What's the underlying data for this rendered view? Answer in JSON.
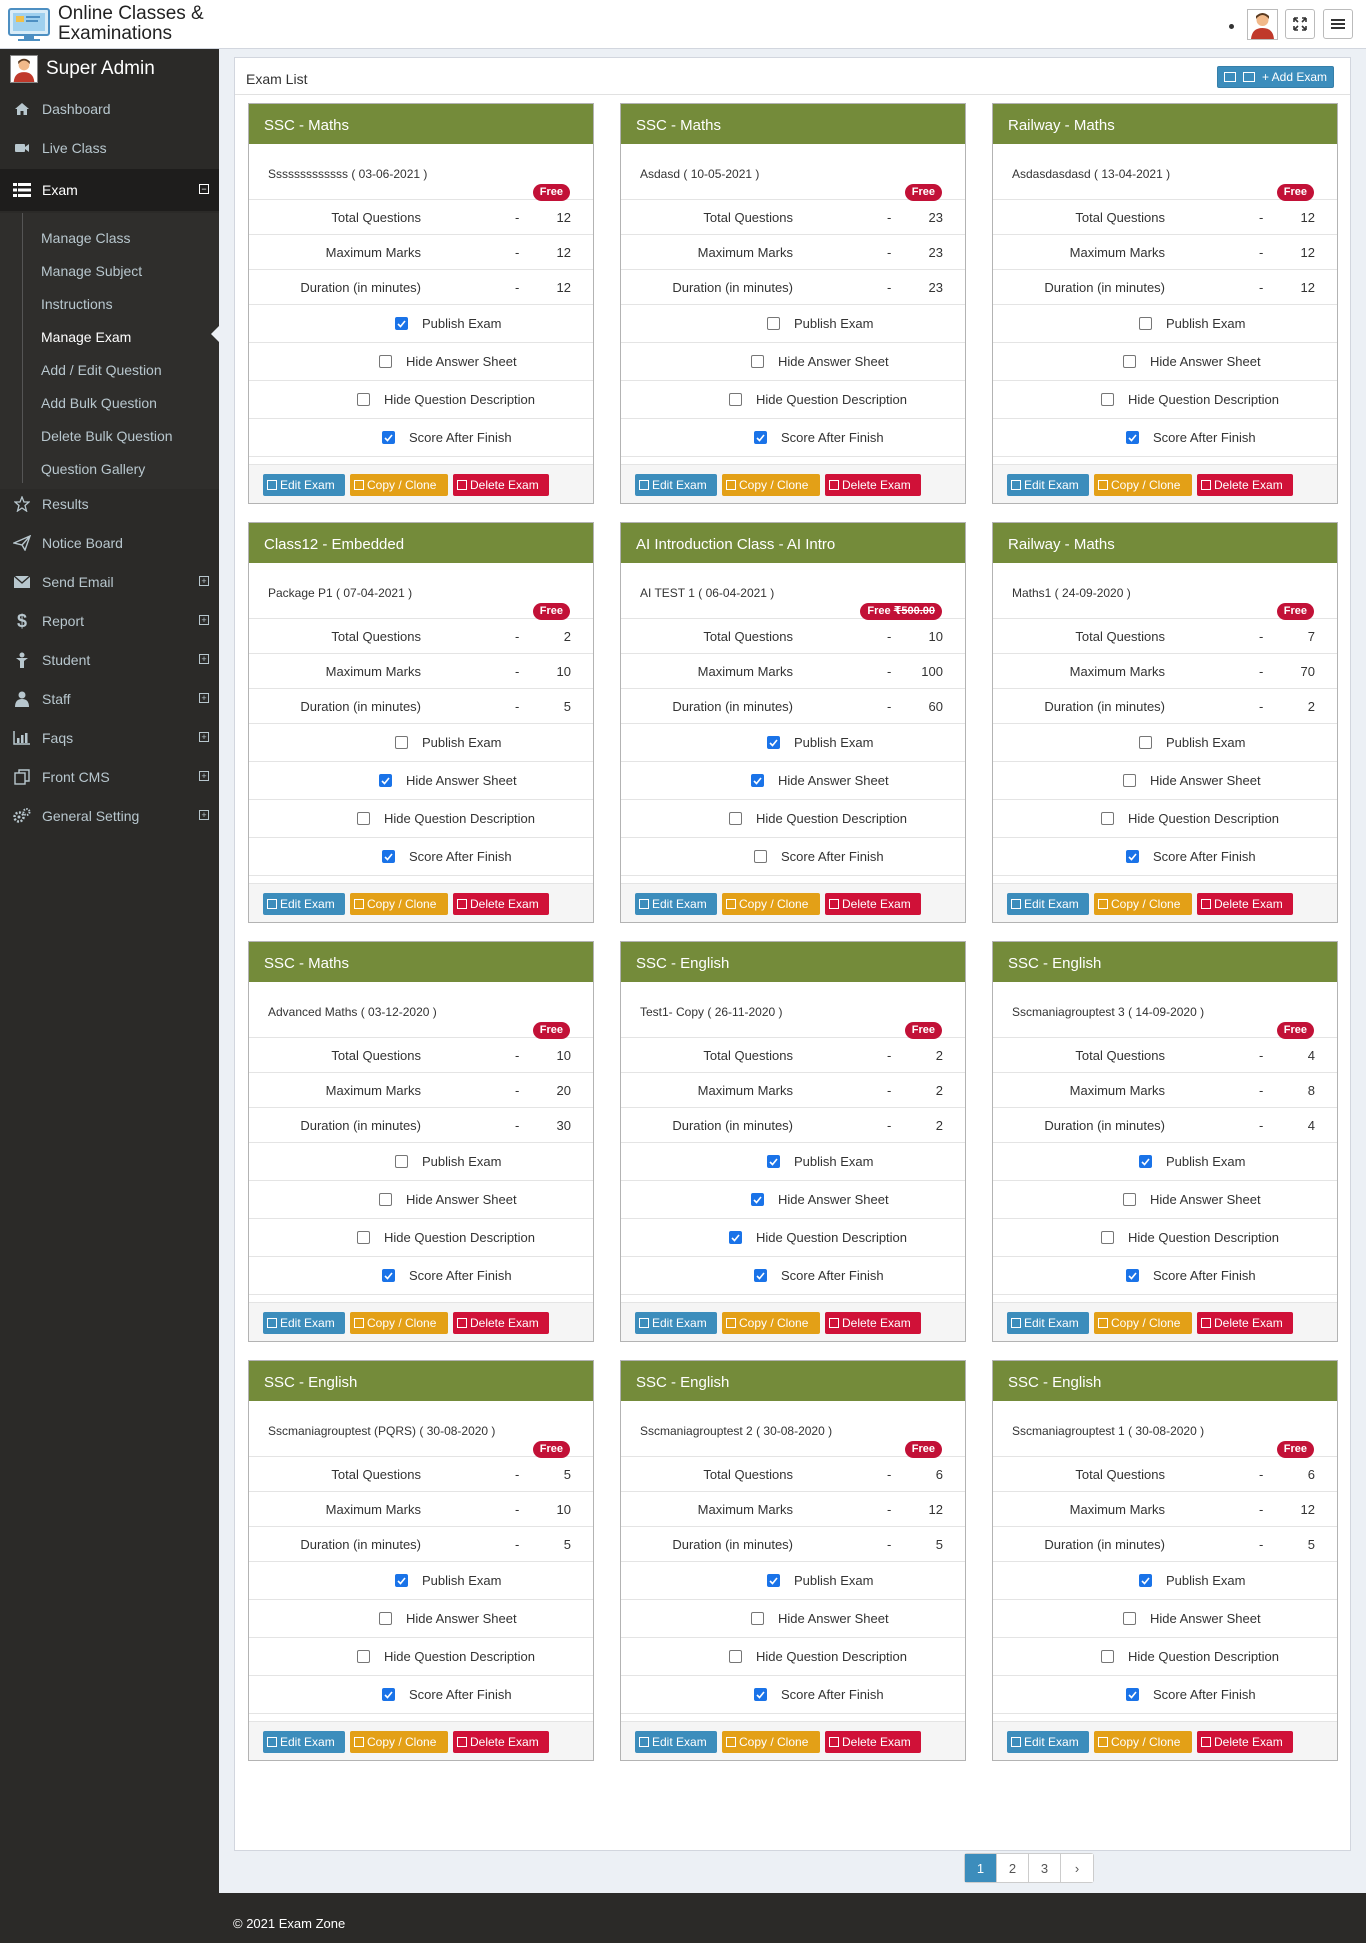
{
  "app": {
    "logo_line1": "Online Classes &",
    "logo_line2": "Examinations"
  },
  "sidebar": {
    "user": "Super Admin",
    "items": [
      {
        "label": "Dashboard"
      },
      {
        "label": "Live Class"
      },
      {
        "label": "Exam"
      },
      {
        "label": "Results"
      },
      {
        "label": "Notice Board"
      },
      {
        "label": "Send Email"
      },
      {
        "label": "Report"
      },
      {
        "label": "Student"
      },
      {
        "label": "Staff"
      },
      {
        "label": "Faqs"
      },
      {
        "label": "Front CMS"
      },
      {
        "label": "General Setting"
      }
    ],
    "exam_sub": [
      {
        "label": "Manage Class"
      },
      {
        "label": "Manage Subject"
      },
      {
        "label": "Instructions"
      },
      {
        "label": "Manage Exam"
      },
      {
        "label": "Add / Edit Question"
      },
      {
        "label": "Add Bulk Question"
      },
      {
        "label": "Delete Bulk Question"
      },
      {
        "label": "Question Gallery"
      }
    ]
  },
  "content": {
    "title": "Exam List",
    "add_label": "+ Add Exam"
  },
  "labels": {
    "total": "Total Questions",
    "max": "Maximum Marks",
    "duration": "Duration (in minutes)",
    "dash": "-",
    "publish": "Publish Exam",
    "hide_answer": "Hide Answer Sheet",
    "hide_desc": "Hide Question Description",
    "score": "Score After Finish",
    "edit": "Edit Exam",
    "clone": "Copy / Clone",
    "delete": "Delete Exam"
  },
  "cards": [
    {
      "title": "SSC - Maths",
      "name": "Sssssssssssss ( 03-06-2021 )",
      "badge": "Free",
      "badge_old": "",
      "total": "12",
      "max": "12",
      "duration": "12",
      "publish": true,
      "hide_answer": false,
      "hide_desc": false,
      "score": true
    },
    {
      "title": "SSC - Maths",
      "name": "Asdasd ( 10-05-2021 )",
      "badge": "Free",
      "badge_old": "",
      "total": "23",
      "max": "23",
      "duration": "23",
      "publish": false,
      "hide_answer": false,
      "hide_desc": false,
      "score": true
    },
    {
      "title": "Railway - Maths",
      "name": "Asdasdasdasd ( 13-04-2021 )",
      "badge": "Free",
      "badge_old": "",
      "total": "12",
      "max": "12",
      "duration": "12",
      "publish": false,
      "hide_answer": false,
      "hide_desc": false,
      "score": true
    },
    {
      "title": "Class12 - Embedded",
      "name": "Package P1 ( 07-04-2021 )",
      "badge": "Free",
      "badge_old": "",
      "total": "2",
      "max": "10",
      "duration": "5",
      "publish": false,
      "hide_answer": true,
      "hide_desc": false,
      "score": true
    },
    {
      "title": "AI Introduction Class - AI Intro",
      "name": "AI TEST 1 ( 06-04-2021 )",
      "badge": "Free",
      "badge_old": "₹500.00",
      "total": "10",
      "max": "100",
      "duration": "60",
      "publish": true,
      "hide_answer": true,
      "hide_desc": false,
      "score": false
    },
    {
      "title": "Railway - Maths",
      "name": "Maths1 ( 24-09-2020 )",
      "badge": "Free",
      "badge_old": "",
      "total": "7",
      "max": "70",
      "duration": "2",
      "publish": false,
      "hide_answer": false,
      "hide_desc": false,
      "score": true
    },
    {
      "title": "SSC - Maths",
      "name": "Advanced Maths ( 03-12-2020 )",
      "badge": "Free",
      "badge_old": "",
      "total": "10",
      "max": "20",
      "duration": "30",
      "publish": false,
      "hide_answer": false,
      "hide_desc": false,
      "score": true
    },
    {
      "title": "SSC - English",
      "name": "Test1- Copy ( 26-11-2020 )",
      "badge": "Free",
      "badge_old": "",
      "total": "2",
      "max": "2",
      "duration": "2",
      "publish": true,
      "hide_answer": true,
      "hide_desc": true,
      "score": true
    },
    {
      "title": "SSC - English",
      "name": "Sscmaniagrouptest 3 ( 14-09-2020 )",
      "badge": "Free",
      "badge_old": "",
      "total": "4",
      "max": "8",
      "duration": "4",
      "publish": true,
      "hide_answer": false,
      "hide_desc": false,
      "score": true
    },
    {
      "title": "SSC - English",
      "name": "Sscmaniagrouptest (PQRS) ( 30-08-2020 )",
      "badge": "Free",
      "badge_old": "",
      "total": "5",
      "max": "10",
      "duration": "5",
      "publish": true,
      "hide_answer": false,
      "hide_desc": false,
      "score": true
    },
    {
      "title": "SSC - English",
      "name": "Sscmaniagrouptest 2 ( 30-08-2020 )",
      "badge": "Free",
      "badge_old": "",
      "total": "6",
      "max": "12",
      "duration": "5",
      "publish": true,
      "hide_answer": false,
      "hide_desc": false,
      "score": true
    },
    {
      "title": "SSC - English",
      "name": "Sscmaniagrouptest 1 ( 30-08-2020 )",
      "badge": "Free",
      "badge_old": "",
      "total": "6",
      "max": "12",
      "duration": "5",
      "publish": true,
      "hide_answer": false,
      "hide_desc": false,
      "score": true
    }
  ],
  "pagination": [
    "1",
    "2",
    "3",
    "›"
  ],
  "footer": "© 2021 Exam Zone",
  "colors": {
    "card_header": "#748b3a",
    "badge": "#c21137",
    "edit": "#3c8dbc",
    "clone": "#e3a017",
    "delete": "#d01138",
    "sidebar": "#2b2a28"
  }
}
